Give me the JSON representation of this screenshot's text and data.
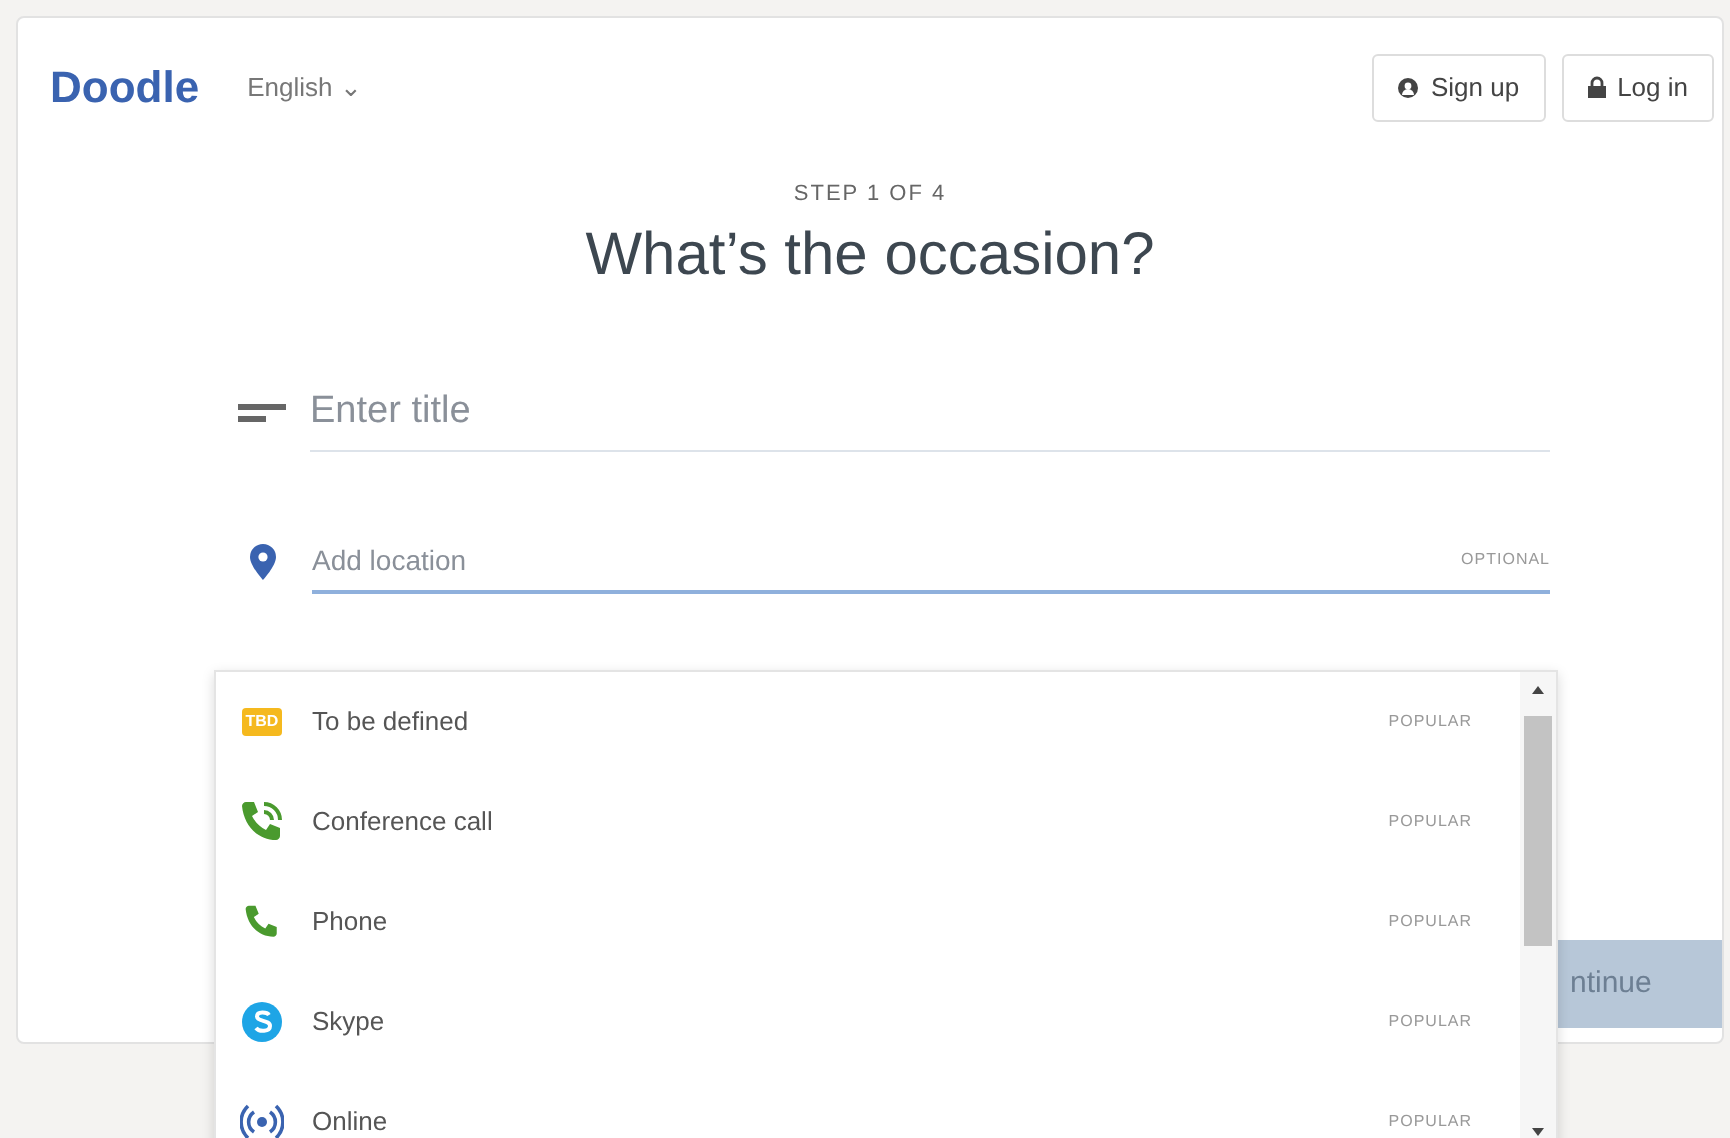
{
  "header": {
    "logo": "Doodle",
    "language": "English",
    "language_caret": "⌄",
    "buttons": [
      {
        "label": "Sign up",
        "kind": "signup"
      },
      {
        "label": "Log in",
        "kind": "login"
      }
    ]
  },
  "step": "STEP 1 OF 4",
  "heading": "What’s the occasion?",
  "title_field": {
    "placeholder": "Enter title"
  },
  "location_field": {
    "placeholder": "Add location",
    "hint": "OPTIONAL",
    "focused": true
  },
  "location_options": [
    {
      "label": "To be defined",
      "tag": "POPULAR",
      "kind": "tbd",
      "badge": "TBD"
    },
    {
      "label": "Conference call",
      "tag": "POPULAR",
      "kind": "conference"
    },
    {
      "label": "Phone",
      "tag": "POPULAR",
      "kind": "phone"
    },
    {
      "label": "Skype",
      "tag": "POPULAR",
      "kind": "skype"
    },
    {
      "label": "Online",
      "tag": "POPULAR",
      "kind": "online"
    }
  ],
  "continue_button": {
    "label": "ntinue",
    "disabled": true
  }
}
